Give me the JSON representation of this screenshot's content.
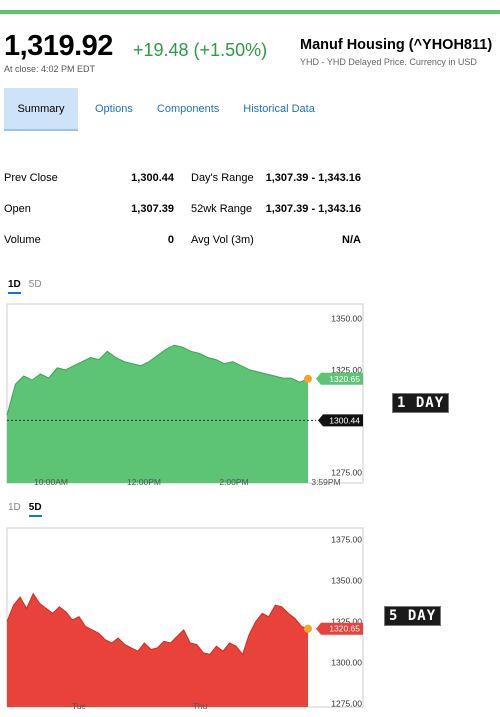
{
  "quote": {
    "price": "1,319.92",
    "change": "+19.48 (+1.50%)",
    "close_note": "At close: 4:02 PM EDT",
    "name": "Manuf Housing (^YHOH811)",
    "subtitle": "YHD - YHD Delayed Price. Currency in USD"
  },
  "tabs": [
    {
      "label": "Summary",
      "active": true
    },
    {
      "label": "Options",
      "active": false
    },
    {
      "label": "Components",
      "active": false
    },
    {
      "label": "Historical Data",
      "active": false
    }
  ],
  "stats": [
    {
      "label1": "Prev Close",
      "value1": "1,300.44",
      "label2": "Day's Range",
      "value2": "1,307.39 - 1,343.16"
    },
    {
      "label1": "Open",
      "value1": "1,307.39",
      "label2": "52wk Range",
      "value2": "1,307.39 - 1,343.16"
    },
    {
      "label1": "Volume",
      "value1": "0",
      "label2": "Avg Vol (3m)",
      "value2": "N/A"
    }
  ],
  "colors": {
    "up_fill": "#5cc474",
    "up_line": "#3aa45a",
    "down_fill": "#e8423b",
    "down_line": "#c92e28",
    "marker": "#f5a623",
    "accent": "#1a73c9"
  },
  "chart_1d": {
    "range_tabs": [
      "1D",
      "5D"
    ],
    "active_range": "1D",
    "side_label": "1 DAY",
    "current_label": "1320.65",
    "prev_close_label": "1300.44",
    "y_ticks": [
      "1350.00",
      "1325.00",
      "1300.00",
      "1275.00"
    ],
    "x_ticks": [
      "10:00AM",
      "12:00PM",
      "2:00PM",
      "3:59PM"
    ]
  },
  "chart_5d": {
    "range_tabs": [
      "1D",
      "5D"
    ],
    "active_range": "5D",
    "side_label": "5 DAY",
    "current_label": "1320.65",
    "y_ticks": [
      "1375.00",
      "1350.00",
      "1325.00",
      "1300.00",
      "1275.00"
    ],
    "x_ticks": [
      "Tue",
      "Thu"
    ]
  },
  "chart_data": [
    {
      "type": "area",
      "x_ticks": [
        "10:00AM",
        "12:00PM",
        "2:00PM",
        "3:59PM"
      ],
      "ylim": [
        1270,
        1357
      ],
      "y": [
        1303,
        1318,
        1322,
        1320,
        1323,
        1321,
        1326,
        1325,
        1327,
        1329,
        1331,
        1330,
        1334,
        1331,
        1329,
        1328,
        1327,
        1329,
        1332,
        1335,
        1337,
        1336,
        1334,
        1333,
        1331,
        1330,
        1328,
        1329,
        1327,
        1325,
        1324,
        1323,
        1322,
        1321,
        1321,
        1319,
        1320.65
      ],
      "reference_line": 1300.44,
      "current": 1320.65
    },
    {
      "type": "area",
      "x_ticks": [
        "Tue",
        "Thu"
      ],
      "ylim": [
        1273,
        1382
      ],
      "y": [
        1325,
        1335,
        1340,
        1333,
        1342,
        1336,
        1333,
        1330,
        1334,
        1331,
        1326,
        1328,
        1322,
        1320,
        1318,
        1314,
        1312,
        1315,
        1311,
        1309,
        1307,
        1312,
        1308,
        1309,
        1313,
        1312,
        1316,
        1320,
        1312,
        1311,
        1306,
        1305,
        1310,
        1307,
        1312,
        1310,
        1305,
        1317,
        1325,
        1330,
        1328,
        1335,
        1334,
        1330,
        1327,
        1322,
        1320.65
      ],
      "current": 1320.65
    }
  ]
}
